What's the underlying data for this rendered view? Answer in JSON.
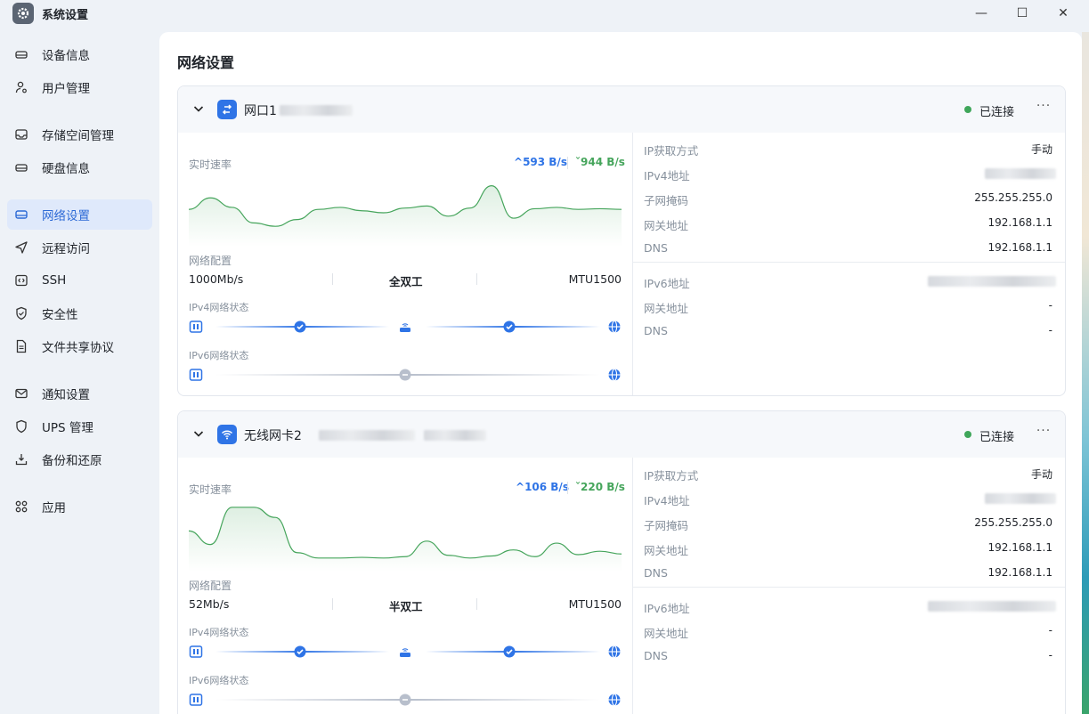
{
  "window": {
    "title": "系统设置",
    "controls": {
      "minimize": "—",
      "maximize": "☐",
      "close": "✕"
    }
  },
  "sidebar": {
    "items": [
      {
        "label": "设备信息",
        "icon": "device-icon"
      },
      {
        "label": "用户管理",
        "icon": "user-icon"
      },
      {
        "label": "存储空间管理",
        "icon": "storage-icon"
      },
      {
        "label": "硬盘信息",
        "icon": "disk-icon"
      },
      {
        "label": "网络设置",
        "icon": "network-icon",
        "active": true
      },
      {
        "label": "远程访问",
        "icon": "send-icon"
      },
      {
        "label": "SSH",
        "icon": "ssh-icon"
      },
      {
        "label": "安全性",
        "icon": "shield-icon"
      },
      {
        "label": "文件共享协议",
        "icon": "file-icon"
      },
      {
        "label": "通知设置",
        "icon": "mail-icon"
      },
      {
        "label": "UPS 管理",
        "icon": "ups-icon"
      },
      {
        "label": "备份和还原",
        "icon": "backup-icon"
      },
      {
        "label": "应用",
        "icon": "apps-icon"
      }
    ]
  },
  "page": {
    "title": "网络设置"
  },
  "cards": [
    {
      "name": "网口1",
      "icon": "ethernet-icon",
      "status": "已连接",
      "more": "···",
      "speed_label": "实时速率",
      "upload": "593 B/s",
      "download": "944 B/s",
      "config_label": "网络配置",
      "link_speed": "1000Mb/s",
      "duplex": "全双工",
      "mtu": "MTU1500",
      "ipv4_state_label": "IPv4网络状态",
      "ipv6_state_label": "IPv6网络状态",
      "ipv4": {
        "method_key": "IP获取方式",
        "method_val": "手动",
        "addr_key": "IPv4地址",
        "mask_key": "子网掩码",
        "mask_val": "255.255.255.0",
        "gw_key": "网关地址",
        "gw_val": "192.168.1.1",
        "dns_key": "DNS",
        "dns_val": "192.168.1.1"
      },
      "ipv6": {
        "addr_key": "IPv6地址",
        "gw_key": "网关地址",
        "gw_val": "-",
        "dns_key": "DNS",
        "dns_val": "-"
      },
      "speed_series": [
        0.45,
        0.28,
        0.42,
        0.65,
        0.7,
        0.6,
        0.45,
        0.42,
        0.47,
        0.5,
        0.43,
        0.4,
        0.55,
        0.43,
        0.1,
        0.58,
        0.44,
        0.42,
        0.45,
        0.44,
        0.45
      ]
    },
    {
      "name": "无线网卡2",
      "icon": "wifi-icon",
      "status": "已连接",
      "more": "···",
      "speed_label": "实时速率",
      "upload": "106 B/s",
      "download": "220 B/s",
      "config_label": "网络配置",
      "link_speed": "52Mb/s",
      "duplex": "半双工",
      "mtu": "MTU1500",
      "ipv4_state_label": "IPv4网络状态",
      "ipv6_state_label": "IPv6网络状态",
      "ipv4": {
        "method_key": "IP获取方式",
        "method_val": "手动",
        "addr_key": "IPv4地址",
        "mask_key": "子网掩码",
        "mask_val": "255.255.255.0",
        "gw_key": "网关地址",
        "gw_val": "192.168.1.1",
        "dns_key": "DNS",
        "dns_val": "192.168.1.1"
      },
      "ipv6": {
        "addr_key": "IPv6地址",
        "gw_key": "网关地址",
        "gw_val": "-",
        "dns_key": "DNS",
        "dns_val": "-"
      },
      "speed_series": [
        0.4,
        0.6,
        0.05,
        0.05,
        0.2,
        0.72,
        0.8,
        0.8,
        0.79,
        0.8,
        0.78,
        0.55,
        0.76,
        0.8,
        0.77,
        0.68,
        0.78,
        0.58,
        0.75,
        0.7,
        0.74
      ]
    }
  ],
  "colors": {
    "accent": "#2f74e6",
    "active_bg": "#dfe9fb",
    "connected": "#3fa65a",
    "chart_line": "#46a55c"
  }
}
